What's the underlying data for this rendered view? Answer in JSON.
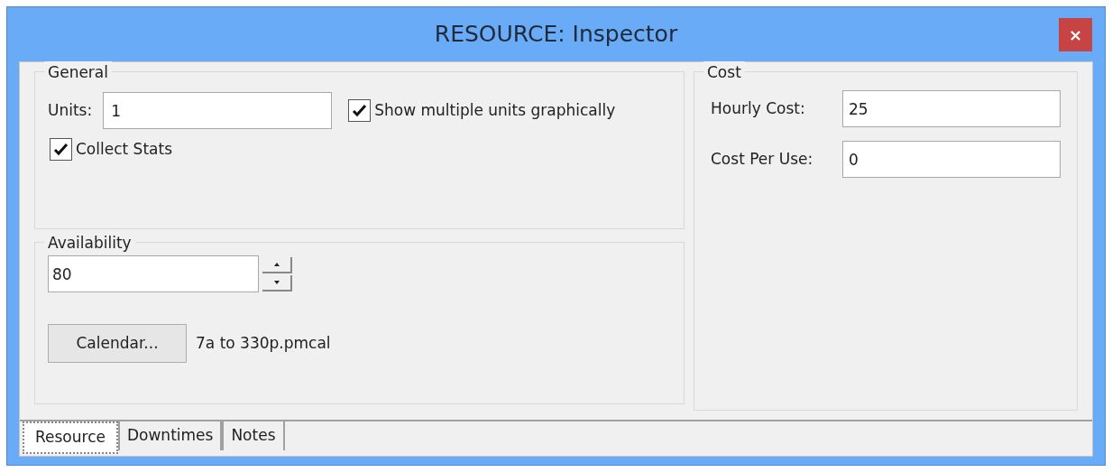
{
  "window": {
    "title": "RESOURCE: Inspector",
    "close": "×"
  },
  "general": {
    "title": "General",
    "units_label": "Units:",
    "units_value": "1",
    "checkboxes": [
      {
        "label": "Show multiple units graphically",
        "checked": true
      },
      {
        "label": "Collect Stats",
        "checked": true
      }
    ]
  },
  "availability": {
    "title": "Availability",
    "value": "80",
    "calendar_button": "Calendar...",
    "calendar_file": "7a to 330p.pmcal"
  },
  "cost": {
    "title": "Cost",
    "fields": [
      {
        "label": "Hourly Cost:",
        "value": "25"
      },
      {
        "label": "Cost Per Use:",
        "value": "0"
      }
    ]
  },
  "tabs": [
    {
      "label": "Resource",
      "selected": true
    },
    {
      "label": "Downtimes",
      "selected": false
    },
    {
      "label": "Notes",
      "selected": false
    }
  ]
}
